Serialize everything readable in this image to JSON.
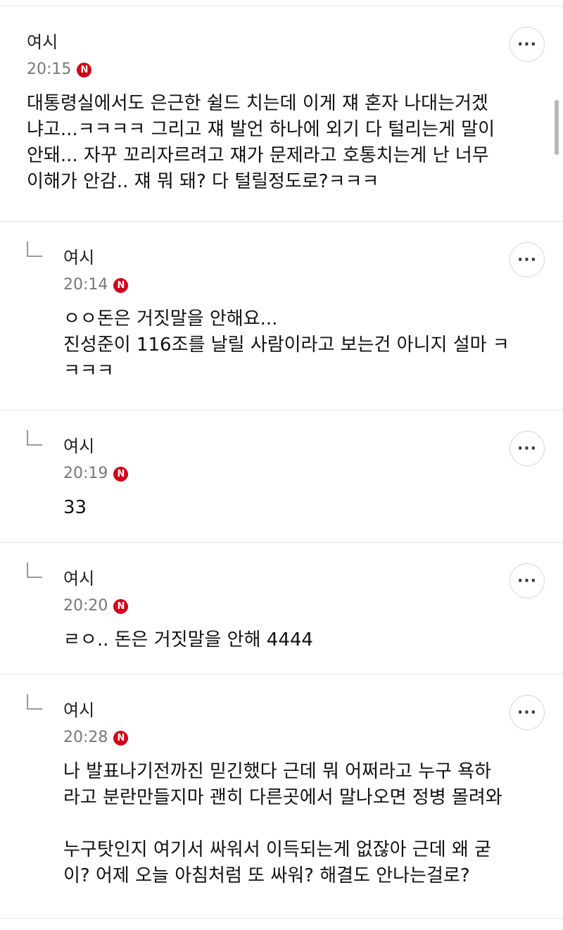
{
  "comments": [
    {
      "author": "여시",
      "time": "20:15",
      "badge": "N",
      "more_label": "···",
      "lines": [
        "대통령실에서도 은근한 쉴드 치는데 이게 쟤 혼자 나대는거겠",
        "냐고...ㅋㅋㅋㅋ 그리고 쟤 발언 하나에 외기 다 털리는게 말이",
        "안돼... 자꾸 꼬리자르려고 쟤가 문제라고 호통치는게 난 너무",
        "이해가 안감.. 쟤 뭐 돼? 다 털릴정도로?ㅋㅋㅋ"
      ]
    },
    {
      "author": "여시",
      "time": "20:14",
      "badge": "N",
      "more_label": "···",
      "lines": [
        "ㅇㅇ돈은 거짓말을 안해요...",
        "진성준이 116조를 날릴 사람이라고 보는건 아니지 설마 ㅋ",
        "ㅋㅋㅋ"
      ]
    },
    {
      "author": "여시",
      "time": "20:19",
      "badge": "N",
      "more_label": "···",
      "lines": [
        "33"
      ]
    },
    {
      "author": "여시",
      "time": "20:20",
      "badge": "N",
      "more_label": "···",
      "lines": [
        "ㄹㅇ.. 돈은 거짓말을 안해 4444"
      ]
    },
    {
      "author": "여시",
      "time": "20:28",
      "badge": "N",
      "more_label": "···",
      "lines": [
        "나 발표나기전까진 믿긴했다 근데 뭐 어쩌라고 누구 욕하",
        "라고 분란만들지마 괜히 다른곳에서 말나오면 정병 몰려와",
        "",
        "누구탓인지 여기서 싸워서 이득되는게 없잖아 근데 왜 굳",
        "이? 어제 오늘 아침처럼 또 싸워? 해결도 안나는걸로?"
      ]
    }
  ]
}
